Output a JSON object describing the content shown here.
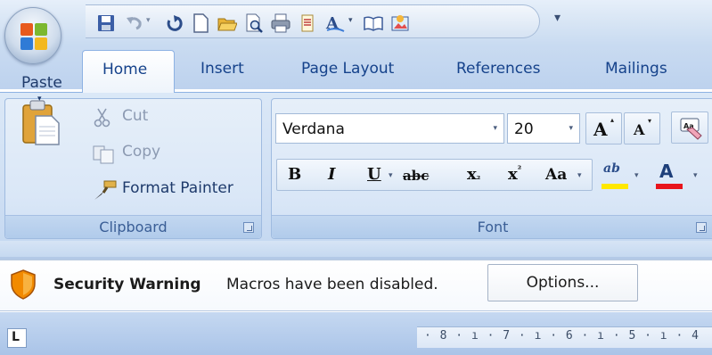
{
  "quick_access": {
    "icons": [
      "save-icon",
      "undo-icon",
      "redo-icon",
      "new-document-icon",
      "open-icon",
      "print-preview-icon",
      "print-icon",
      "document-icon",
      "text-style-icon",
      "book-icon",
      "picture-icon"
    ],
    "more_glyph": "▾"
  },
  "tabs": [
    {
      "label": "Home",
      "active": true
    },
    {
      "label": "Insert",
      "active": false
    },
    {
      "label": "Page Layout",
      "active": false
    },
    {
      "label": "References",
      "active": false
    },
    {
      "label": "Mailings",
      "active": false
    }
  ],
  "clipboard": {
    "paste_label": "Paste",
    "paste_arrow": "▾",
    "cut_label": "Cut",
    "copy_label": "Copy",
    "format_painter_label": "Format Painter",
    "group_label": "Clipboard"
  },
  "font": {
    "font_name": "Verdana",
    "font_size": "20",
    "grow_glyph": "A",
    "shrink_glyph": "A",
    "bold_glyph": "B",
    "italic_glyph": "I",
    "underline_glyph": "U",
    "strikethrough_glyph": "abc",
    "subscript_glyph": "x",
    "superscript_glyph": "x",
    "change_case_glyph": "Aa",
    "highlight_glyph": "ab",
    "font_color_glyph": "A",
    "group_label": "Font"
  },
  "security_bar": {
    "title": "Security Warning",
    "message": "Macros have been disabled.",
    "options_label": "Options..."
  },
  "ruler": {
    "corner_glyph": "L",
    "marks": "· 8 · ı · 7 · ı · 6 · ı · 5 · ı · 4"
  },
  "colors": {
    "accent": "#15428b",
    "highlight_yellow": "#ffe800",
    "font_color_red": "#e8141c",
    "shield_orange": "#f28a00"
  }
}
